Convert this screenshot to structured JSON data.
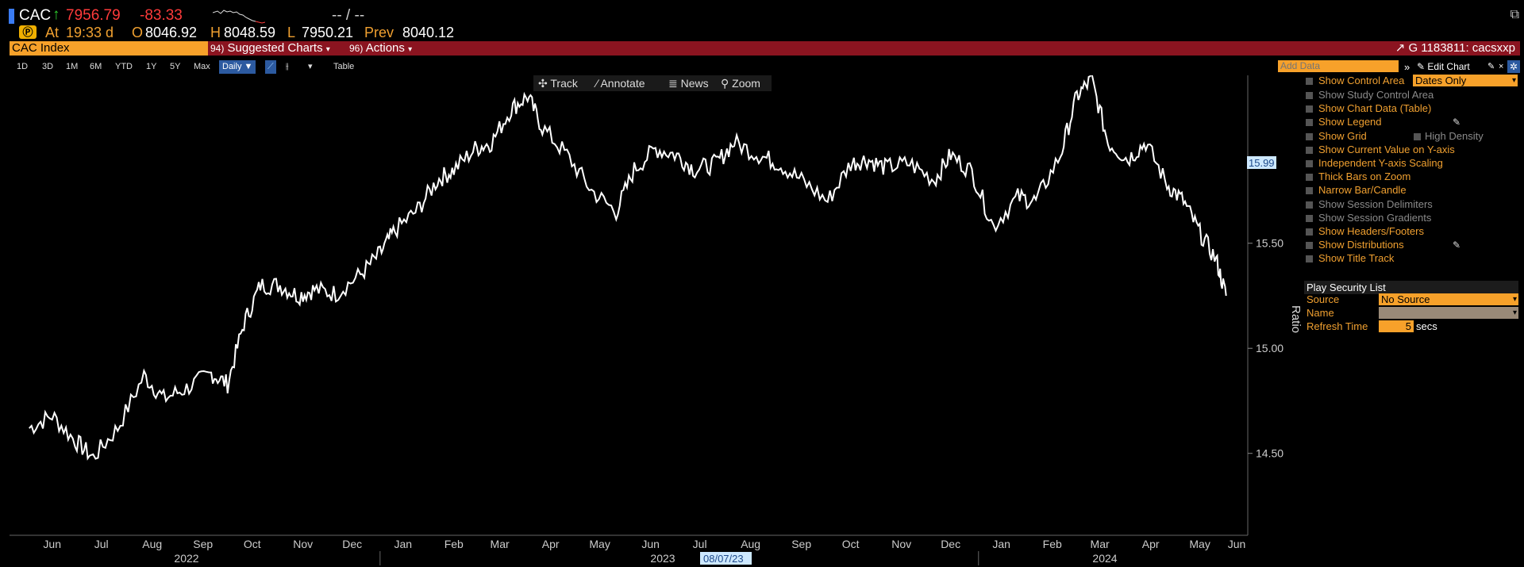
{
  "quote": {
    "ticker": "CAC",
    "last": "7956.79",
    "change": "-83.33",
    "placeholder": "-- / --",
    "at_label": "At",
    "time": "19:33 d",
    "open_label": "O",
    "open": "8046.92",
    "high_label": "H",
    "high": "8048.59",
    "low_label": "L",
    "low": "7950.21",
    "prev_label": "Prev",
    "prev": "8040.12"
  },
  "title_bar": {
    "security": "CAC Index",
    "suggested_charts": "Suggested Charts",
    "actions": "Actions",
    "chart_id": "G 1183811: cacsxxp"
  },
  "toolbar": {
    "periods": [
      "1D",
      "3D",
      "1M",
      "6M",
      "YTD",
      "1Y",
      "5Y",
      "Max"
    ],
    "frequency": "Daily",
    "table": "Table",
    "add_data_placeholder": "Add Data",
    "edit_chart": "Edit Chart"
  },
  "chart_tools": [
    "Track",
    "Annotate",
    "News",
    "Zoom"
  ],
  "options": {
    "show_control_area": "Show Control Area",
    "dates_only": "Dates Only",
    "items": [
      {
        "label": "Show Study Control Area",
        "enabled": false
      },
      {
        "label": "Show Chart Data (Table)",
        "enabled": true
      },
      {
        "label": "Show Legend",
        "enabled": true
      },
      {
        "label": "Show Grid",
        "enabled": true
      },
      {
        "label": "Show Current Value on Y-axis",
        "enabled": true
      },
      {
        "label": "Independent Y-axis Scaling",
        "enabled": true
      },
      {
        "label": "Thick Bars on Zoom",
        "enabled": true
      },
      {
        "label": "Narrow Bar/Candle",
        "enabled": true
      },
      {
        "label": "Show Session Delimiters",
        "enabled": false
      },
      {
        "label": "Show Session Gradients",
        "enabled": false
      },
      {
        "label": "Show Headers/Footers",
        "enabled": true
      },
      {
        "label": "Show Distributions",
        "enabled": true
      },
      {
        "label": "Show Title Track",
        "enabled": true
      }
    ],
    "high_density": "High Density"
  },
  "play_security": {
    "header": "Play Security List",
    "source_label": "Source",
    "source_value": "No Source",
    "name_label": "Name",
    "name_value": "",
    "refresh_label": "Refresh Time",
    "refresh_value": "5",
    "refresh_unit": "secs"
  },
  "colors": {
    "accent_orange": "#f7a12a",
    "title_bar_red": "#8b1420",
    "price_red": "#ff3b3b",
    "up_green": "#2fd12f",
    "toolbar_blue": "#2c5aa0"
  },
  "chart_data": {
    "type": "line",
    "ylabel": "Ratio",
    "ylim": [
      14.28,
      15.98
    ],
    "y_ticks": [
      14.5,
      15.0,
      15.5
    ],
    "y_tick_labels": [
      "14.50",
      "15.00",
      "15.50"
    ],
    "current_value": "15.99",
    "months": [
      "Jun",
      "Jul",
      "Aug",
      "Sep",
      "Oct",
      "Nov",
      "Dec",
      "Jan",
      "Feb",
      "Mar",
      "Apr",
      "May",
      "Jun",
      "Jul",
      "Aug",
      "Sep",
      "Oct",
      "Nov",
      "Dec",
      "Jan",
      "Feb",
      "Mar",
      "Apr",
      "May",
      "Jun"
    ],
    "years": [
      "2022",
      "2023",
      "2024"
    ],
    "cursor_date": "08/07/23",
    "series": [
      {
        "x": [
          "2022-06-01",
          "2022-06-15",
          "2022-06-29",
          "2022-07-10",
          "2022-07-25",
          "2022-08-10",
          "2022-08-22",
          "2022-09-05",
          "2022-09-20",
          "2022-09-30",
          "2022-10-10",
          "2022-10-20",
          "2022-11-01",
          "2022-11-12",
          "2022-11-22",
          "2022-12-05",
          "2022-12-20",
          "2023-01-01",
          "2023-01-10",
          "2023-01-24",
          "2023-02-05",
          "2023-02-15",
          "2023-02-28",
          "2023-03-10",
          "2023-03-22",
          "2023-04-01",
          "2023-04-10",
          "2023-04-25",
          "2023-05-10",
          "2023-05-25",
          "2023-06-05",
          "2023-06-18",
          "2023-07-01",
          "2023-07-12",
          "2023-07-25",
          "2023-08-05",
          "2023-08-20",
          "2023-09-01",
          "2023-09-15",
          "2023-10-01",
          "2023-10-15",
          "2023-10-25",
          "2023-11-05",
          "2023-11-20",
          "2023-12-05",
          "2023-12-15",
          "2023-12-28",
          "2024-01-10",
          "2024-01-25",
          "2024-02-05",
          "2024-02-20",
          "2024-03-01",
          "2024-03-10",
          "2024-03-20",
          "2024-04-01",
          "2024-04-12",
          "2024-04-25",
          "2024-05-05",
          "2024-05-15",
          "2024-05-25",
          "2024-05-31"
        ],
        "y": [
          14.62,
          14.68,
          14.56,
          14.48,
          14.62,
          14.87,
          14.76,
          14.81,
          14.88,
          14.83,
          15.12,
          15.3,
          15.3,
          15.25,
          15.28,
          15.26,
          15.35,
          15.45,
          15.56,
          15.66,
          15.8,
          15.85,
          15.95,
          15.98,
          16.14,
          16.2,
          16.05,
          15.92,
          15.75,
          15.65,
          15.85,
          15.95,
          15.92,
          15.85,
          15.88,
          15.98,
          15.92,
          15.88,
          15.8,
          15.7,
          15.88,
          15.9,
          15.86,
          15.88,
          15.8,
          15.92,
          15.84,
          15.58,
          15.72,
          15.7,
          15.92,
          16.2,
          16.28,
          15.98,
          15.9,
          15.98,
          15.78,
          15.7,
          15.55,
          15.42,
          15.25
        ]
      }
    ]
  }
}
